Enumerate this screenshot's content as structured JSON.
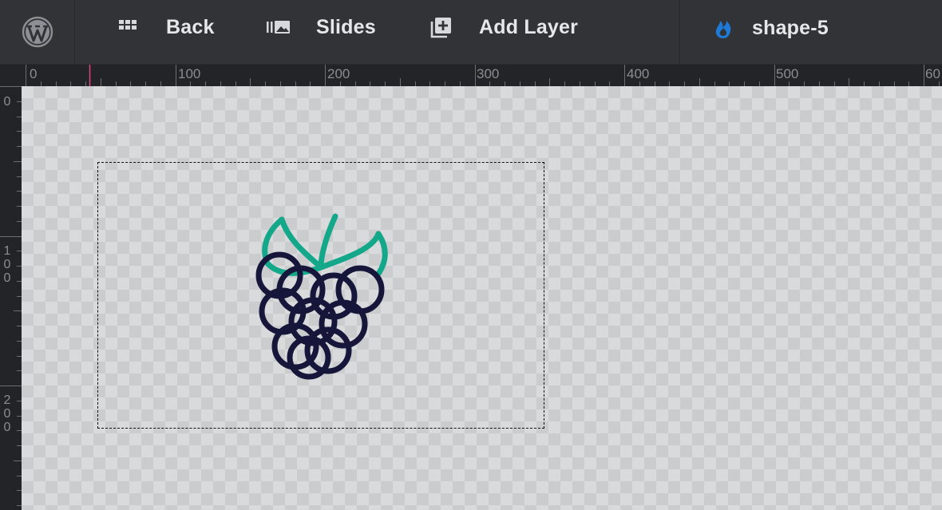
{
  "toolbar": {
    "logo_icon": "wordpress-icon",
    "back": {
      "label": "Back",
      "icon": "grid-icon"
    },
    "slides": {
      "label": "Slides",
      "icon": "slides-icon"
    },
    "add_layer": {
      "label": "Add Layer",
      "icon": "add-layer-icon"
    },
    "layer": {
      "name": "shape-5",
      "icon": "flame-icon"
    }
  },
  "ruler": {
    "horizontal_labels": [
      "0",
      "100",
      "200",
      "300",
      "400",
      "500",
      "60"
    ],
    "vertical_labels": [
      "0",
      "1\n0\n0",
      "2\n0\n0"
    ]
  },
  "colors": {
    "toolbar_bg": "#323336",
    "text": "#e6e7e9",
    "accent_blue": "#1e7ad6",
    "marker_pink": "#e0447a",
    "berry_stroke": "#15163a",
    "leaf_stroke": "#14a88a"
  },
  "layer_content": {
    "shape_icon": "raspberry-icon"
  }
}
